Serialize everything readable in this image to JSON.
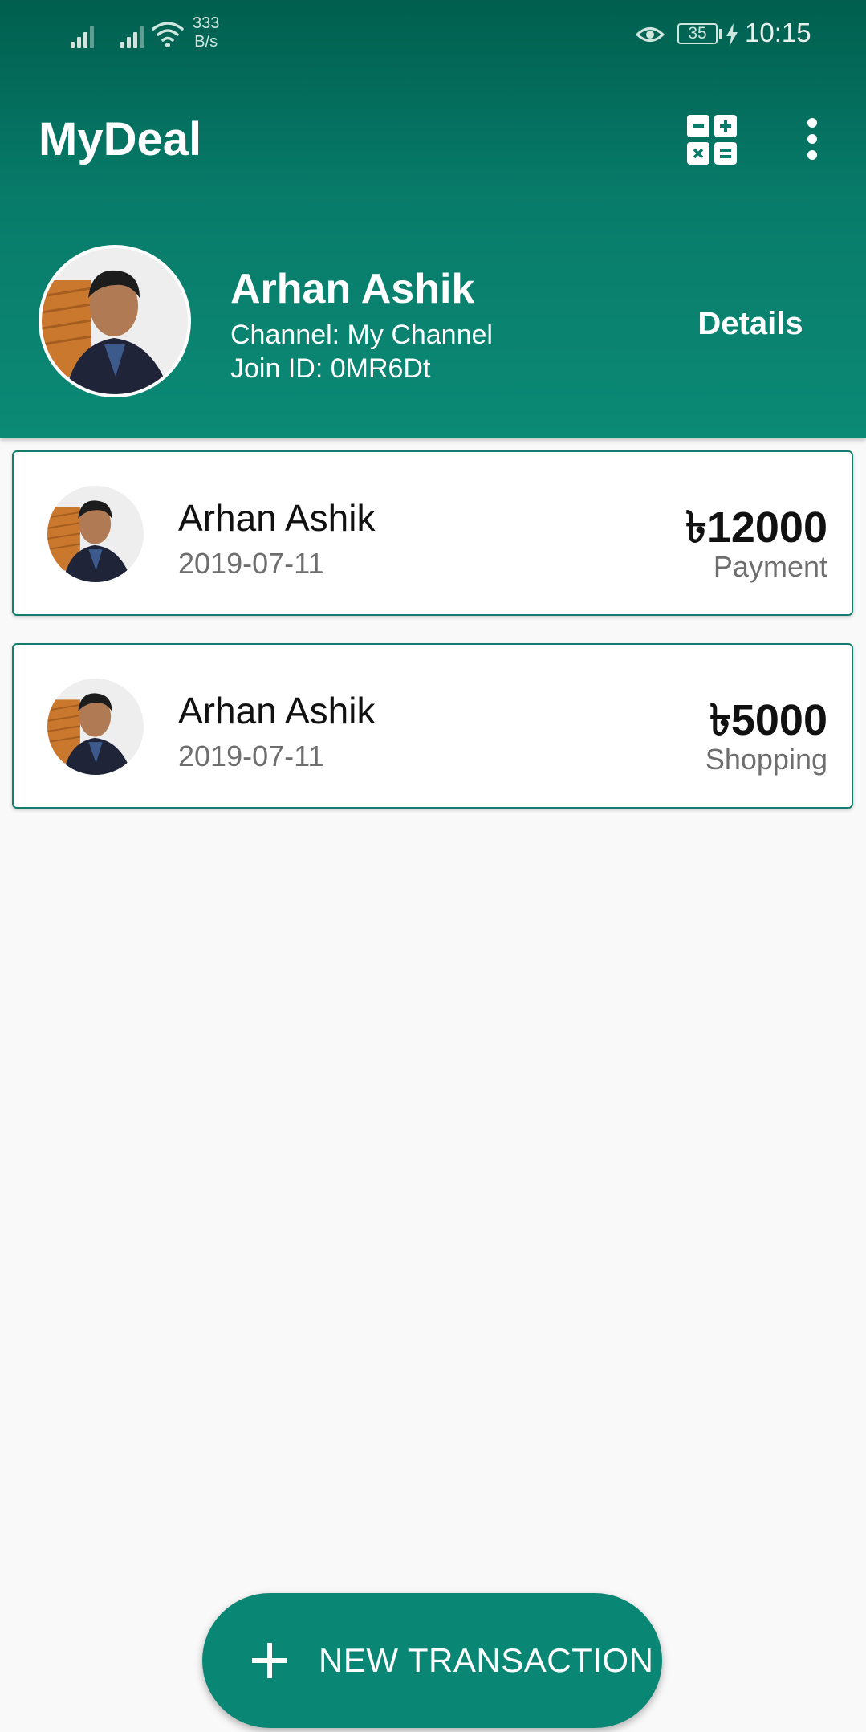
{
  "status_bar": {
    "net_speed_value": "333",
    "net_speed_unit": "B/s",
    "battery": "35",
    "time": "10:15",
    "icons": [
      "signal-icon",
      "signal-icon",
      "wifi-icon",
      "eye-icon",
      "battery-icon",
      "charging-icon"
    ]
  },
  "app_bar": {
    "title": "MyDeal",
    "icons": [
      "calculator-icon",
      "more-vert-icon"
    ]
  },
  "profile": {
    "name": "Arhan Ashik",
    "channel": "Channel: My Channel",
    "join_id": "Join ID: 0MR6Dt",
    "details_label": "Details"
  },
  "transactions": [
    {
      "name": "Arhan Ashik",
      "date": "2019-07-11",
      "amount": "৳12000",
      "type": "Payment"
    },
    {
      "name": "Arhan Ashik",
      "date": "2019-07-11",
      "amount": "৳5000",
      "type": "Shopping"
    }
  ],
  "fab": {
    "label": "NEW TRANSACTION",
    "icon": "plus-icon"
  },
  "colors": {
    "primary": "#0b8a76",
    "primary_dark": "#005f4f",
    "background": "#f9f9f9",
    "card_border": "#137e6c"
  }
}
